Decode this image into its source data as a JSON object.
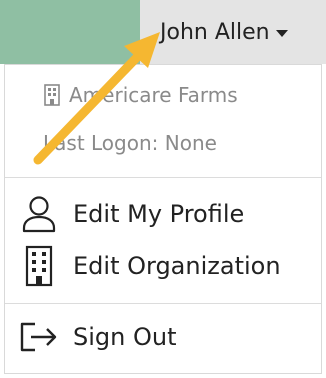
{
  "header": {
    "user_name": "John Allen"
  },
  "dropdown": {
    "organization": "Americare Farms",
    "last_logon": "Last Logon: None",
    "items": [
      {
        "label": "Edit My Profile",
        "icon": "user-icon"
      },
      {
        "label": "Edit Organization",
        "icon": "building-icon"
      },
      {
        "label": "Sign Out",
        "icon": "sign-out-icon"
      }
    ]
  },
  "colors": {
    "header_green": "#8fbfa3",
    "header_gray": "#e4e4e4",
    "annotation_arrow": "#f5b731"
  }
}
